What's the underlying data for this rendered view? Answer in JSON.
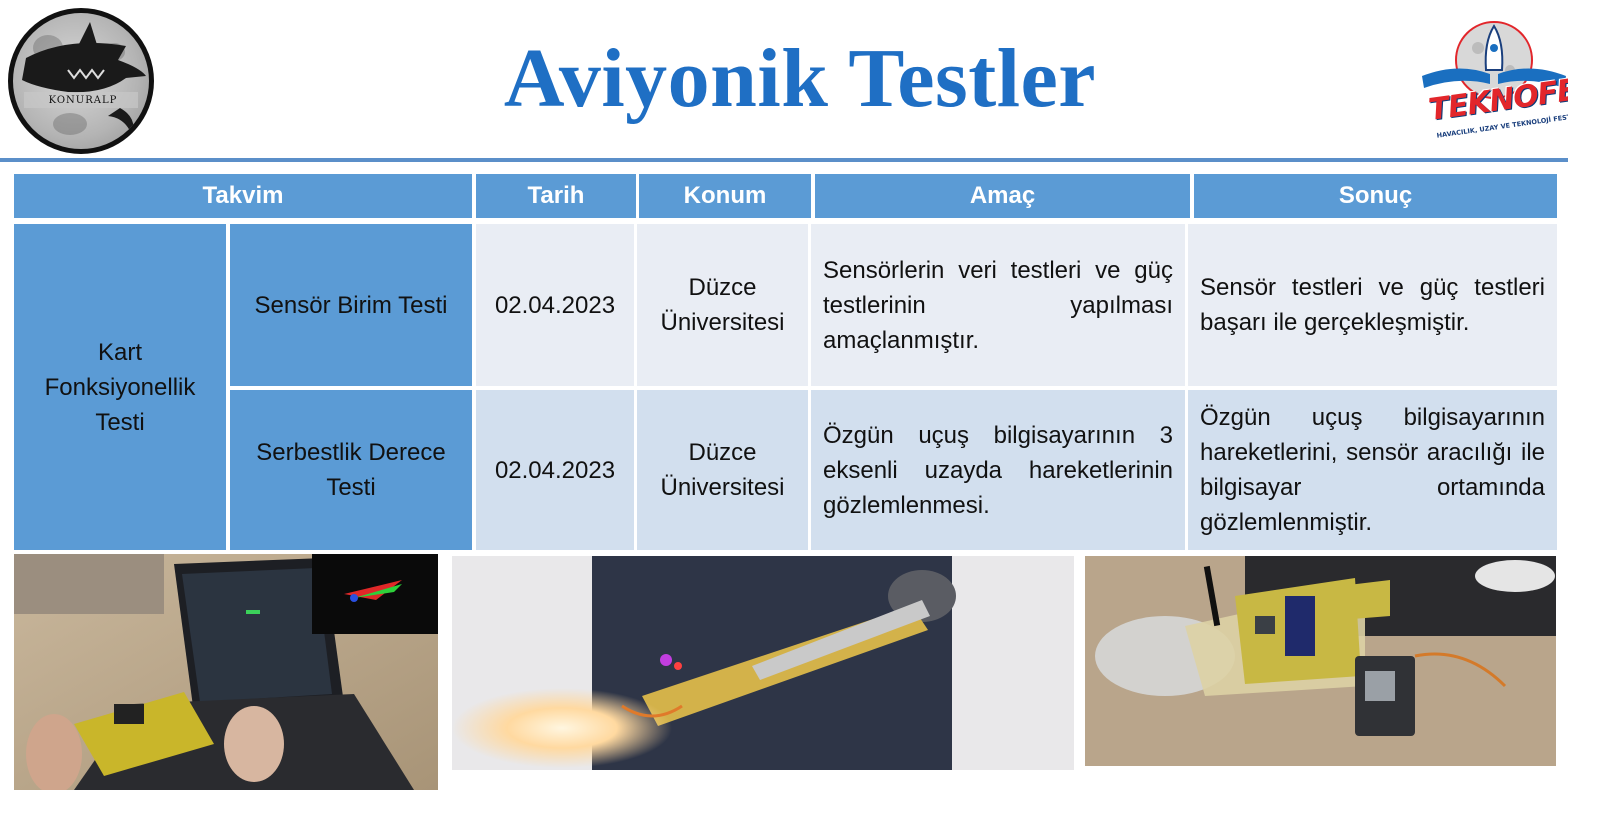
{
  "header": {
    "title": "Aviyonik Testler",
    "left_logo_text": "KONURALP",
    "right_logo_text": "TEKNOFEST",
    "right_logo_subtext": "HAVACILIK, UZAY VE TEKNOLOJİ FESTİVALİ"
  },
  "table": {
    "headers": [
      "Takvim",
      "Tarih",
      "Konum",
      "Amaç",
      "Sonuç"
    ],
    "group_label": "Kart Fonksiyonellik Testi",
    "rows": [
      {
        "test": "Sensör Birim Testi",
        "date": "02.04.2023",
        "location": "Düzce Üniversitesi",
        "purpose": "Sensörlerin veri testleri ve güç testlerinin yapılması amaçlanmıştır.",
        "result": "Sensör testleri ve güç testleri başarı ile gerçekleşmiştir."
      },
      {
        "test": "Serbestlik Derece Testi",
        "date": "02.04.2023",
        "location": "Düzce Üniversitesi",
        "purpose": "Özgün uçuş bilgisayarının 3 eksenli uzayda hareketlerinin gözlemlenmesi.",
        "result": "Özgün uçuş bilgisayarının hareketlerini, sensör aracılığı ile bilgisayar ortamında gözlemlenmiştir."
      }
    ]
  },
  "colors": {
    "title": "#1f6fc4",
    "header_fill": "#5b9bd5",
    "row1_fill": "#e9edf4",
    "row2_fill": "#d2dfee",
    "rule": "#5b8fc9"
  }
}
